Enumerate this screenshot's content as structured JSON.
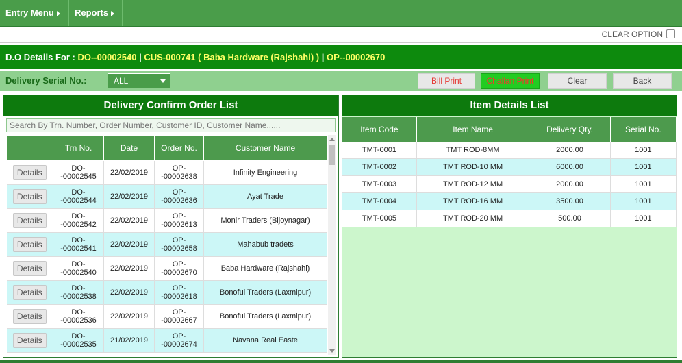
{
  "menu": {
    "entry": "Entry Menu",
    "reports": "Reports"
  },
  "clear_option": "CLEAR OPTION",
  "do_bar": {
    "label": "D.O Details For :",
    "do_no": "DO--00002540",
    "sep1": " | ",
    "cus": "CUS-000741",
    "customer": "( Baba Hardware (Rajshahi) )",
    "sep2": " | ",
    "op": "OP--00002670"
  },
  "controls": {
    "serial_label": "Delivery Serial No.:",
    "serial_value": "ALL",
    "bill_print": "Bill Print",
    "challan_print": "Challan Print",
    "clear": "Clear",
    "back": "Back"
  },
  "left_panel": {
    "title": "Delivery Confirm Order List",
    "search_placeholder": "Search By Trn. Number, Order Number, Customer ID, Customer Name......",
    "columns": [
      "",
      "Trn No.",
      "Date",
      "Order No.",
      "Customer Name"
    ],
    "details_label": "Details",
    "rows": [
      {
        "trn1": "DO-",
        "trn2": "-00002545",
        "date": "22/02/2019",
        "ord1": "OP-",
        "ord2": "-00002638",
        "customer": "Infinity Engineering"
      },
      {
        "trn1": "DO-",
        "trn2": "-00002544",
        "date": "22/02/2019",
        "ord1": "OP-",
        "ord2": "-00002636",
        "customer": "Ayat Trade"
      },
      {
        "trn1": "DO-",
        "trn2": "-00002542",
        "date": "22/02/2019",
        "ord1": "OP-",
        "ord2": "-00002613",
        "customer": "Monir Traders (Bijoynagar)"
      },
      {
        "trn1": "DO-",
        "trn2": "-00002541",
        "date": "22/02/2019",
        "ord1": "OP-",
        "ord2": "-00002658",
        "customer": "Mahabub tradets"
      },
      {
        "trn1": "DO-",
        "trn2": "-00002540",
        "date": "22/02/2019",
        "ord1": "OP-",
        "ord2": "-00002670",
        "customer": "Baba Hardware (Rajshahi)"
      },
      {
        "trn1": "DO-",
        "trn2": "-00002538",
        "date": "22/02/2019",
        "ord1": "OP-",
        "ord2": "-00002618",
        "customer": "Bonoful Traders (Laxmipur)"
      },
      {
        "trn1": "DO-",
        "trn2": "-00002536",
        "date": "22/02/2019",
        "ord1": "OP-",
        "ord2": "-00002667",
        "customer": "Bonoful Traders (Laxmipur)"
      },
      {
        "trn1": "DO-",
        "trn2": "-00002535",
        "date": "21/02/2019",
        "ord1": "OP-",
        "ord2": "-00002674",
        "customer": "Navana Real Easte"
      }
    ]
  },
  "right_panel": {
    "title": "Item Details List",
    "columns": [
      "Item Code",
      "Item Name",
      "Delivery Qty.",
      "Serial No."
    ],
    "rows": [
      {
        "code": "TMT-0001",
        "name": "TMT ROD-8MM",
        "qty": "2000.00",
        "serial": "1001"
      },
      {
        "code": "TMT-0002",
        "name": "TMT ROD-10 MM",
        "qty": "6000.00",
        "serial": "1001"
      },
      {
        "code": "TMT-0003",
        "name": "TMT ROD-12 MM",
        "qty": "2000.00",
        "serial": "1001"
      },
      {
        "code": "TMT-0004",
        "name": "TMT ROD-16 MM",
        "qty": "3500.00",
        "serial": "1001"
      },
      {
        "code": "TMT-0005",
        "name": "TMT ROD-20 MM",
        "qty": "500.00",
        "serial": "1001"
      }
    ]
  }
}
